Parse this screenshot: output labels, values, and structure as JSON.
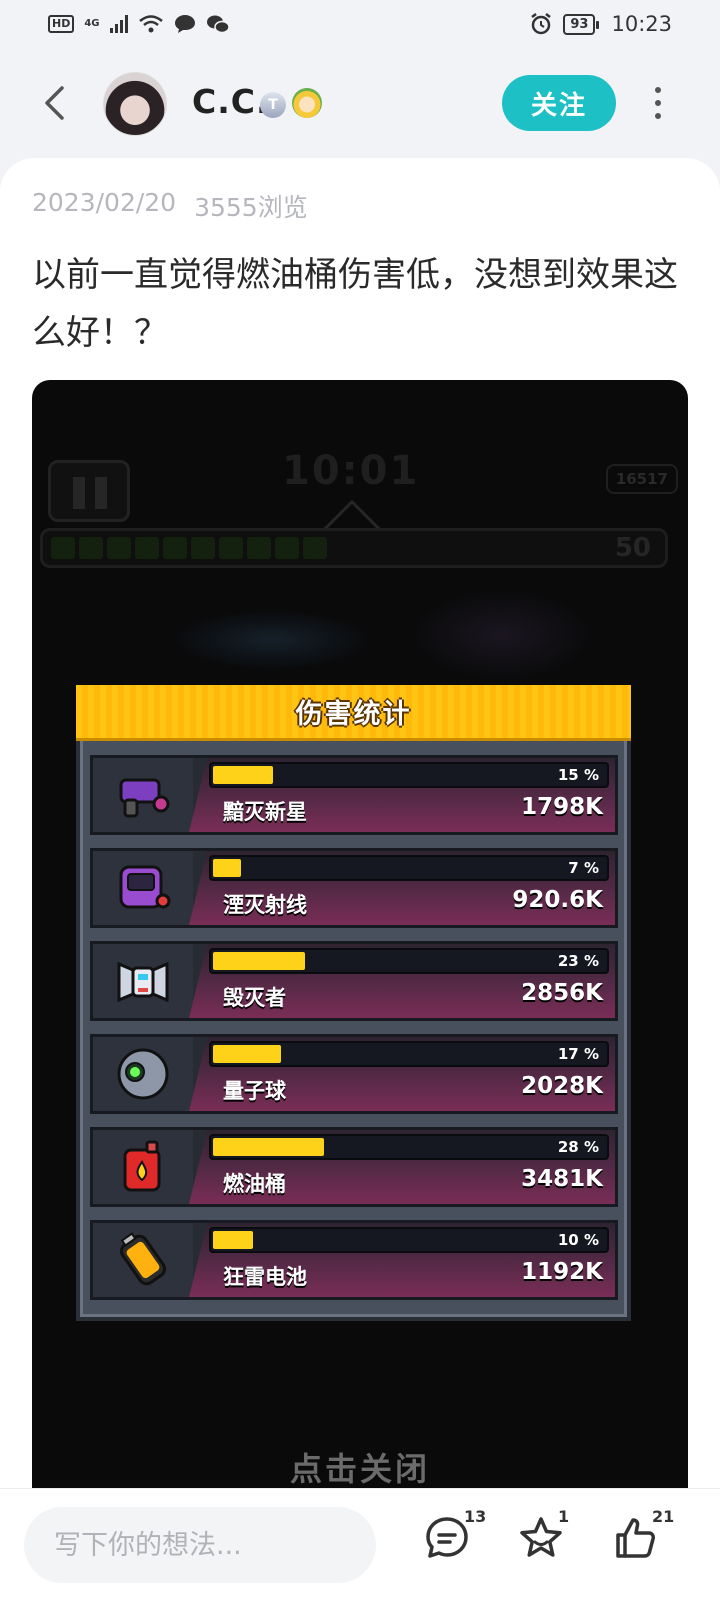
{
  "status_bar": {
    "hd_label": "HD",
    "network_label": "4G",
    "battery": "93",
    "time": "10:23"
  },
  "header": {
    "username": "C.C.",
    "level_badge": "T",
    "follow_label": "关注"
  },
  "post": {
    "date": "2023/02/20",
    "views": "3555浏览",
    "text": "以前一直觉得燃油桶伤害低，没想到效果这么好！？"
  },
  "game": {
    "timer": "10:01",
    "coins": "16517",
    "level": "50",
    "panel_title": "伤害统计",
    "close_hint": "点击关闭",
    "colors": {
      "bar_fill": "#ffd21a",
      "header": "#ffc515",
      "row_gradient_end": "#7a2d56"
    },
    "rows": [
      {
        "name": "黯灭新星",
        "percent_label": "15 %",
        "percent": 15,
        "value": "1798K",
        "icon": "nova-gun-icon"
      },
      {
        "name": "湮灭射线",
        "percent_label": "7 %",
        "percent": 7,
        "value": "920.6K",
        "icon": "ray-device-icon"
      },
      {
        "name": "毁灭者",
        "percent_label": "23 %",
        "percent": 23,
        "value": "2856K",
        "icon": "destroyer-icon"
      },
      {
        "name": "量子球",
        "percent_label": "17 %",
        "percent": 17,
        "value": "2028K",
        "icon": "quantum-ball-icon"
      },
      {
        "name": "燃油桶",
        "percent_label": "28 %",
        "percent": 28,
        "value": "3481K",
        "icon": "fuel-can-icon"
      },
      {
        "name": "狂雷电池",
        "percent_label": "10 %",
        "percent": 10,
        "value": "1192K",
        "icon": "thunder-battery-icon"
      }
    ]
  },
  "bottom_bar": {
    "comment_placeholder": "写下你的想法...",
    "comments_count": "13",
    "favorites_count": "1",
    "likes_count": "21"
  }
}
